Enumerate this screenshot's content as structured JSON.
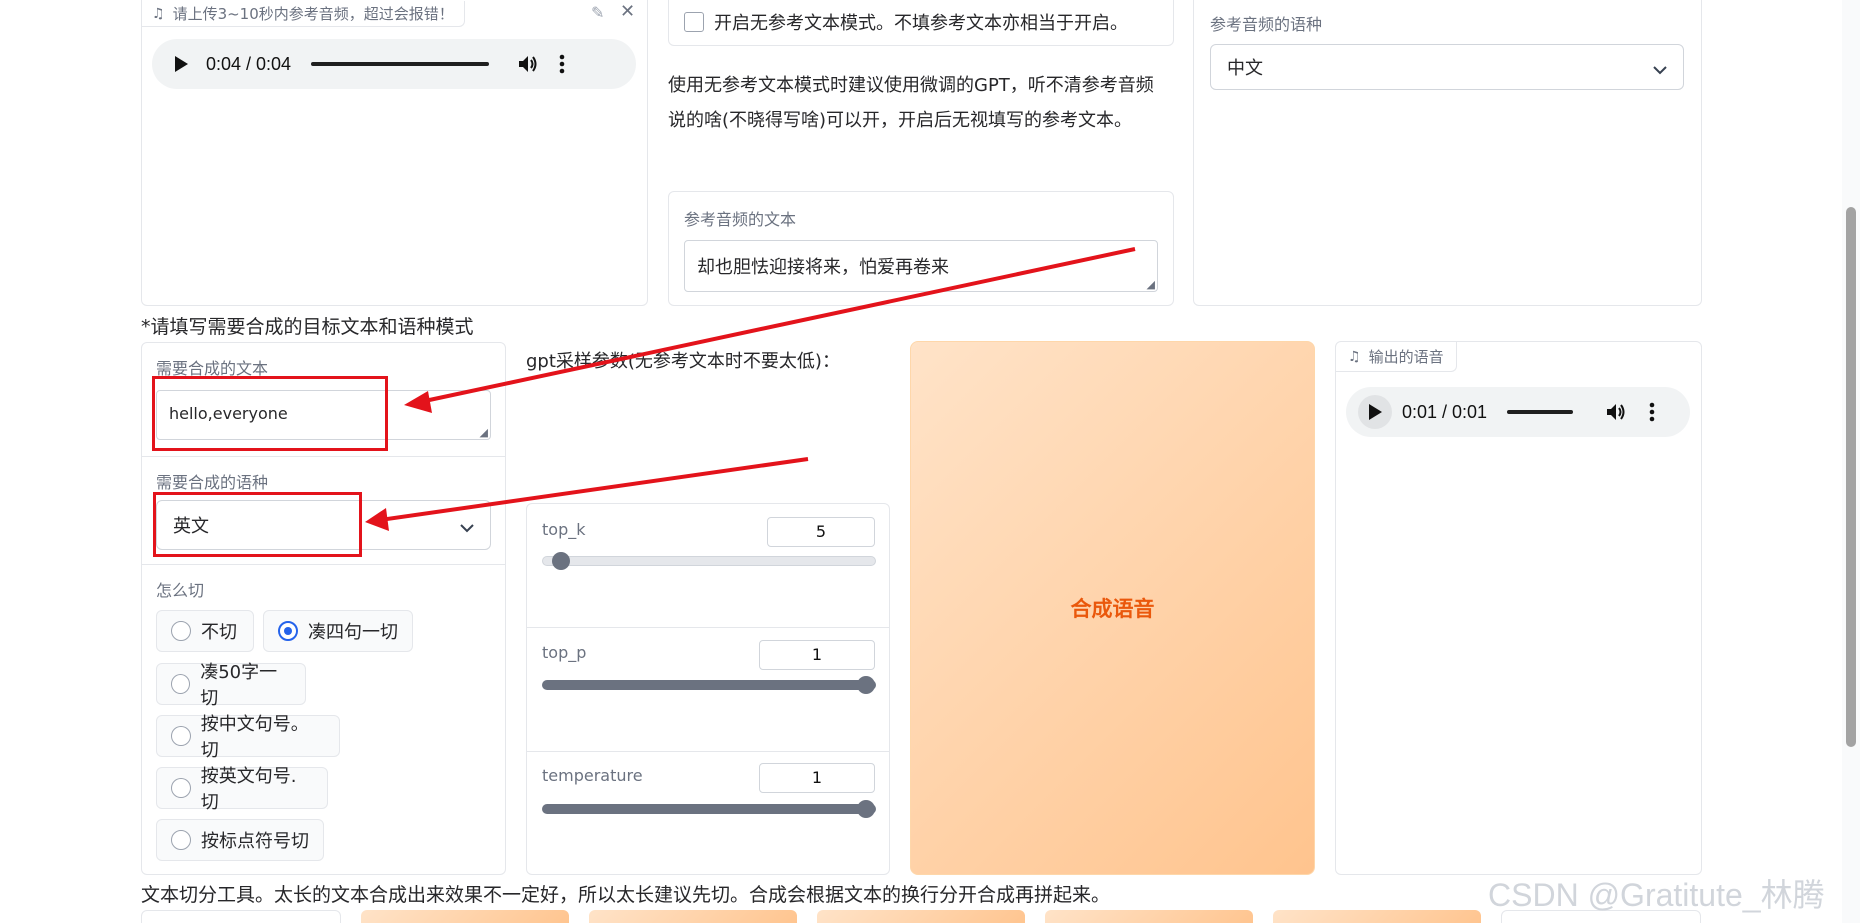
{
  "ref_audio": {
    "label": "请上传3~10秒内参考音频，超过会报错！",
    "time": "0:04 / 0:04"
  },
  "no_ref_mode": {
    "checkbox_label": "开启无参考文本模式。不填参考文本亦相当于开启。",
    "hint": "使用无参考文本模式时建议使用微调的GPT，听不清参考音频说的啥(不晓得写啥)可以开，开启后无视填写的参考文本。"
  },
  "ref_text": {
    "label": "参考音频的文本",
    "value": "却也胆怯迎接将来，怕爱再卷来"
  },
  "ref_lang": {
    "label": "参考音频的语种",
    "value": "中文"
  },
  "target_section_title": "*请填写需要合成的目标文本和语种模式",
  "target_text": {
    "label": "需要合成的文本",
    "value": "hello,everyone"
  },
  "target_lang": {
    "label": "需要合成的语种",
    "value": "英文"
  },
  "cut": {
    "label": "怎么切",
    "options": [
      "不切",
      "凑四句一切",
      "凑50字一切",
      "按中文句号。切",
      "按英文句号.切",
      "按标点符号切"
    ],
    "selected": "凑四句一切"
  },
  "gpt_params": {
    "title": "gpt采样参数(无参考文本时不要太低)：",
    "top_k": {
      "label": "top_k",
      "value": "5",
      "fraction": 0.05
    },
    "top_p": {
      "label": "top_p",
      "value": "1",
      "fraction": 1.0
    },
    "temperature": {
      "label": "temperature",
      "value": "1",
      "fraction": 1.0
    }
  },
  "synth_button": "合成语音",
  "output_audio": {
    "label": "输出的语音",
    "time": "0:01 / 0:01"
  },
  "split_tool_text": "文本切分工具。太长的文本合成出来效果不一定好，所以太长建议先切。合成会根据文本的换行分开合成再拼起来。",
  "watermark": "CSDN @Gratitute_林腾",
  "colors": {
    "accent_orange": "#ea580c",
    "radio_blue": "#2563eb",
    "annotation_red": "#e3131b"
  }
}
